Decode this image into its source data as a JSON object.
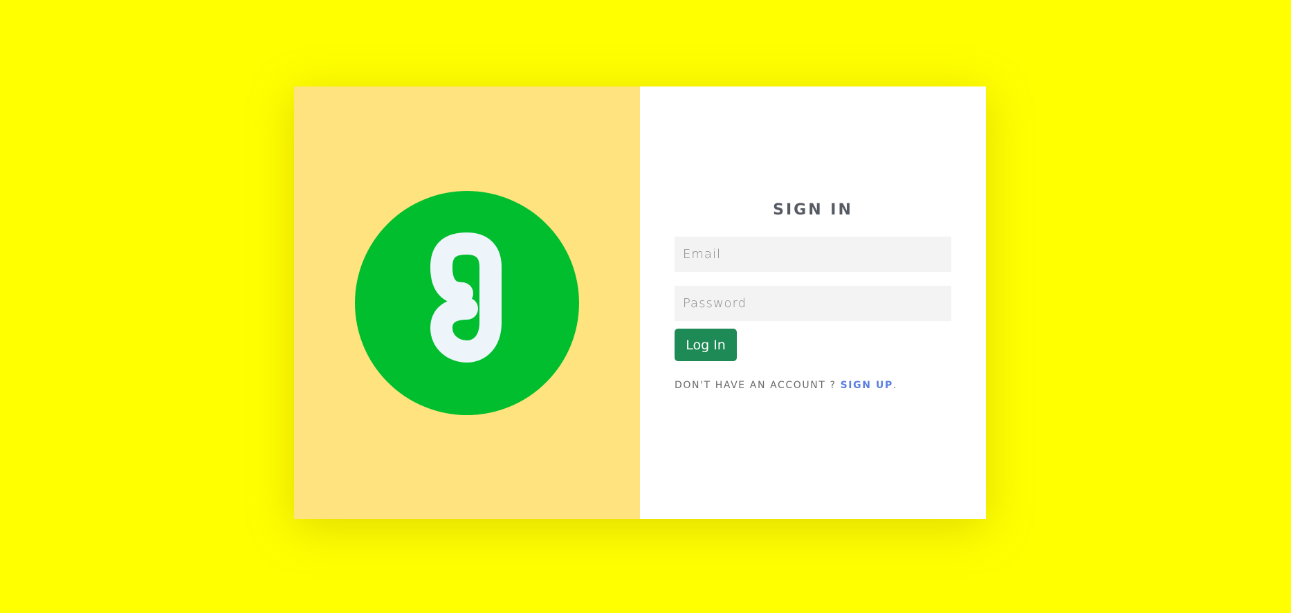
{
  "colors": {
    "page_background": "#ffff00",
    "left_panel": "#ffe37e",
    "logo_circle": "#00be2e",
    "logo_glyph": "#eef5fa",
    "button": "#1e8a56",
    "link": "#5a7fe0"
  },
  "brand": {
    "logo_icon": "g-logo-icon"
  },
  "form": {
    "title": "SIGN IN",
    "email_placeholder": "Email",
    "password_placeholder": "Password",
    "login_label": "Log In",
    "no_account_text": "DON'T HAVE AN ACCOUNT ? ",
    "signup_label": "SIGN UP",
    "signup_suffix": "."
  }
}
